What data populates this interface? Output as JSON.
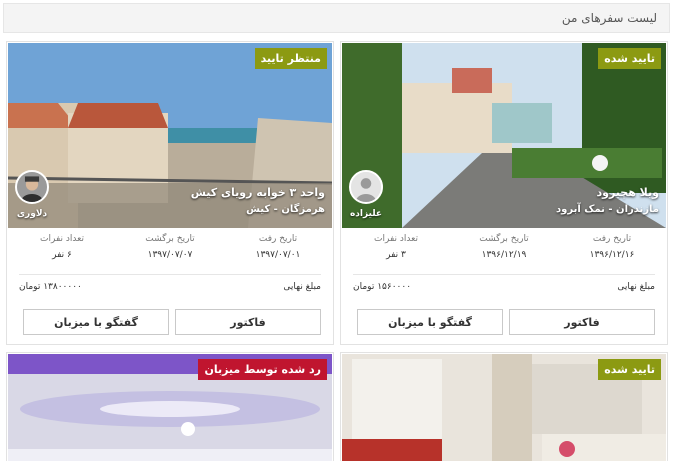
{
  "header": {
    "title": "لیست سفرهای من"
  },
  "labels": {
    "checkin": "تاریخ رفت",
    "checkout": "تاریخ برگشت",
    "guests": "تعداد نفرات",
    "final_amount": "مبلغ نهایی",
    "invoice": "فاکتور",
    "chat": "گفتگو با میزبان"
  },
  "cards": [
    {
      "status": "تایید شده",
      "status_color": "#8c9a12",
      "title": "ویلا هچیرود",
      "location": "مازندران - نمک آبرود",
      "host": "علیزاده",
      "checkin": "۱۳۹۶/۱۲/۱۶",
      "checkout": "۱۳۹۶/۱۲/۱۹",
      "guests": "۳ نفر",
      "amount": "۱۵۶۰۰۰۰ تومان"
    },
    {
      "status": "منتظر تایید",
      "status_color": "#8c9a12",
      "title": "واحد ۳ خوابه رویای کیش",
      "location": "هرمزگان - کیش",
      "host": "دلاوری",
      "checkin": "۱۳۹۷/۰۷/۰۱",
      "checkout": "۱۳۹۷/۰۷/۰۷",
      "guests": "۶ نفر",
      "amount": "۱۳۸۰۰۰۰۰ تومان"
    },
    {
      "status": "تایید شده",
      "status_color": "#8c9a12"
    },
    {
      "status": "رد شده توسط میزبان",
      "status_color": "#c0152f"
    }
  ]
}
